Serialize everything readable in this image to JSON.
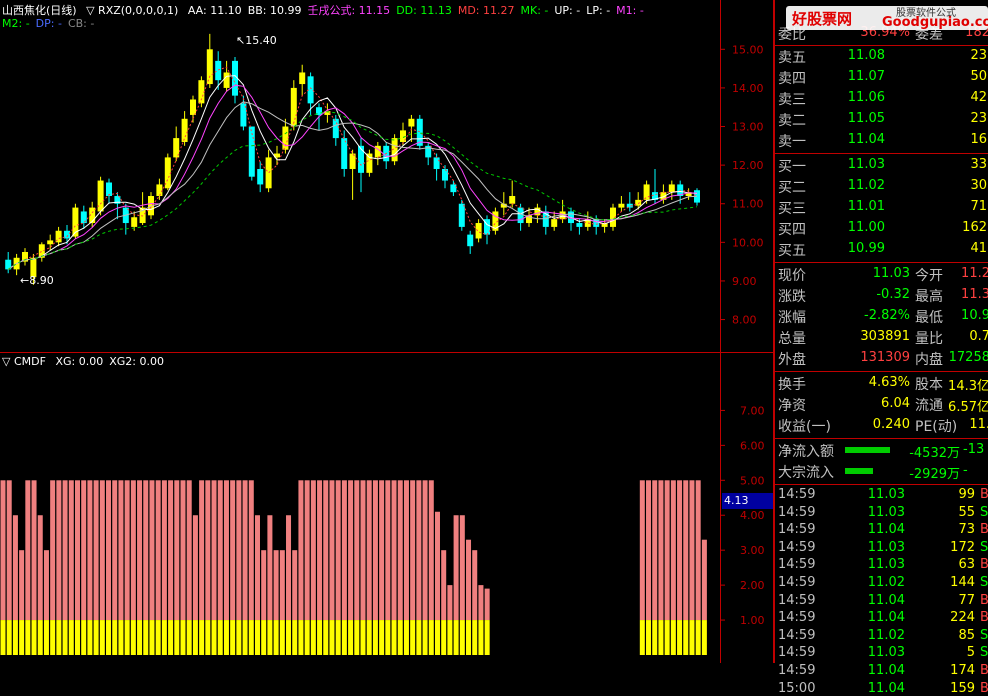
{
  "legend_main": {
    "title": "山西焦化(日线)",
    "indicator": "▽ RXZ(0,0,0,0,1)",
    "items": [
      {
        "label": "AA: 11.10",
        "color": "#ffffff"
      },
      {
        "label": "BB: 10.99",
        "color": "#ffffff"
      },
      {
        "label": "壬戌公式: 11.15",
        "color": "#ff44ff"
      },
      {
        "label": "DD: 11.13",
        "color": "#00ff00"
      },
      {
        "label": "MD: 11.27",
        "color": "#ff4040"
      },
      {
        "label": "MK: -",
        "color": "#00ff00"
      },
      {
        "label": "UP: -",
        "color": "#ffffff"
      },
      {
        "label": "LP: -",
        "color": "#ffffff"
      },
      {
        "label": "M1: -",
        "color": "#ff44ff"
      }
    ],
    "row2": [
      {
        "label": "M2: -",
        "color": "#00ff00"
      },
      {
        "label": "DP: -",
        "color": "#4a6bff"
      },
      {
        "label": "CB: -",
        "color": "#888888"
      }
    ]
  },
  "legend_sub": {
    "indicator": "▽ CMDF",
    "items": [
      {
        "label": "XG: 0.00",
        "color": "#ffffff"
      },
      {
        "label": "XG2: 0.00",
        "color": "#ffffff"
      }
    ]
  },
  "price_axis": [
    "15.00",
    "14.00",
    "13.00",
    "12.00",
    "11.00",
    "10.00",
    "9.00",
    "8.00"
  ],
  "sub_axis": [
    "7.00",
    "6.00",
    "5.00",
    "4.00",
    "3.00",
    "2.00",
    "1.00"
  ],
  "sub_current": "4.13",
  "annotations": {
    "high": "15.40",
    "low": "8.90"
  },
  "watermark": {
    "logo": "好股票网",
    "url": "Goodgupiao.com",
    "tag": "股票软件公式"
  },
  "quote_panel": {
    "ratio": {
      "label": "委比",
      "value": "36.94%",
      "label2": "委差",
      "value2": "182"
    },
    "sells": [
      {
        "label": "卖五",
        "price": "11.08",
        "vol": "23"
      },
      {
        "label": "卖四",
        "price": "11.07",
        "vol": "50"
      },
      {
        "label": "卖三",
        "price": "11.06",
        "vol": "42"
      },
      {
        "label": "卖二",
        "price": "11.05",
        "vol": "23"
      },
      {
        "label": "卖一",
        "price": "11.04",
        "vol": "16"
      }
    ],
    "buys": [
      {
        "label": "买一",
        "price": "11.03",
        "vol": "33"
      },
      {
        "label": "买二",
        "price": "11.02",
        "vol": "30"
      },
      {
        "label": "买三",
        "price": "11.01",
        "vol": "71"
      },
      {
        "label": "买四",
        "price": "11.00",
        "vol": "162"
      },
      {
        "label": "买五",
        "price": "10.99",
        "vol": "41"
      }
    ],
    "stats": [
      {
        "l1": "现价",
        "v1": "11.03",
        "c1": "#00ff00",
        "l2": "今开",
        "v2": "11.2",
        "c2": "#ff4040"
      },
      {
        "l1": "涨跌",
        "v1": "-0.32",
        "c1": "#00ff00",
        "l2": "最高",
        "v2": "11.3",
        "c2": "#ff4040"
      },
      {
        "l1": "涨幅",
        "v1": "-2.82%",
        "c1": "#00ff00",
        "l2": "最低",
        "v2": "10.9",
        "c2": "#00ff00"
      },
      {
        "l1": "总量",
        "v1": "303891",
        "c1": "#ffff00",
        "l2": "量比",
        "v2": "0.7",
        "c2": "#ffff00"
      },
      {
        "l1": "外盘",
        "v1": "131309",
        "c1": "#ff4040",
        "l2": "内盘",
        "v2": "17258",
        "c2": "#00ff00"
      }
    ],
    "stats2": [
      {
        "l1": "换手",
        "v1": "4.63%",
        "c1": "#ffff00",
        "l2": "股本",
        "v2": "14.3亿",
        "c2": "#ffff00"
      },
      {
        "l1": "净资",
        "v1": "6.04",
        "c1": "#ffff00",
        "l2": "流通",
        "v2": "6.57亿",
        "c2": "#ffff00"
      },
      {
        "l1": "收益(一)",
        "v1": "0.240",
        "c1": "#ffff00",
        "l2": "PE(动)",
        "v2": "11.",
        "c2": "#ffff00"
      }
    ],
    "flows": [
      {
        "label": "净流入额",
        "value": "-4532万",
        "value2": "-13"
      },
      {
        "label": "大宗流入",
        "value": "-2929万",
        "value2": "-"
      }
    ],
    "ticks": [
      {
        "time": "14:59",
        "price": "11.03",
        "vol": "99",
        "dir": "B"
      },
      {
        "time": "14:59",
        "price": "11.03",
        "vol": "55",
        "dir": "S"
      },
      {
        "time": "14:59",
        "price": "11.04",
        "vol": "73",
        "dir": "B"
      },
      {
        "time": "14:59",
        "price": "11.03",
        "vol": "172",
        "dir": "S"
      },
      {
        "time": "14:59",
        "price": "11.03",
        "vol": "63",
        "dir": "B"
      },
      {
        "time": "14:59",
        "price": "11.02",
        "vol": "144",
        "dir": "S"
      },
      {
        "time": "14:59",
        "price": "11.04",
        "vol": "77",
        "dir": "B"
      },
      {
        "time": "14:59",
        "price": "11.04",
        "vol": "224",
        "dir": "B"
      },
      {
        "time": "14:59",
        "price": "11.02",
        "vol": "85",
        "dir": "S"
      },
      {
        "time": "14:59",
        "price": "11.03",
        "vol": "5",
        "dir": "S"
      },
      {
        "time": "14:59",
        "price": "11.04",
        "vol": "174",
        "dir": "B"
      },
      {
        "time": "15:00",
        "price": "11.04",
        "vol": "159",
        "dir": "B"
      }
    ]
  },
  "colors": {
    "up": "#ffff00",
    "down": "#00ffff",
    "grid": "#800000",
    "axis": "#c00000",
    "bar_pink": "#f08080",
    "bar_yellow": "#ffff00"
  },
  "chart_data": {
    "type": "candlestick",
    "price_range": [
      7.6,
      15.5
    ],
    "candles": [
      {
        "o": 9.55,
        "c": 9.3,
        "h": 9.75,
        "l": 9.2
      },
      {
        "o": 9.3,
        "c": 9.6,
        "h": 9.7,
        "l": 9.15
      },
      {
        "o": 9.5,
        "c": 9.75,
        "h": 9.85,
        "l": 9.4
      },
      {
        "o": 9.1,
        "c": 9.6,
        "h": 9.7,
        "l": 8.9
      },
      {
        "o": 9.6,
        "c": 9.95,
        "h": 10.0,
        "l": 9.5
      },
      {
        "o": 9.95,
        "c": 10.05,
        "h": 10.2,
        "l": 9.8
      },
      {
        "o": 10.0,
        "c": 10.3,
        "h": 10.4,
        "l": 9.9
      },
      {
        "o": 10.3,
        "c": 10.1,
        "h": 10.45,
        "l": 9.95
      },
      {
        "o": 10.15,
        "c": 10.9,
        "h": 11.0,
        "l": 10.1
      },
      {
        "o": 10.8,
        "c": 10.5,
        "h": 10.95,
        "l": 10.35
      },
      {
        "o": 10.5,
        "c": 10.9,
        "h": 11.05,
        "l": 10.4
      },
      {
        "o": 10.8,
        "c": 11.6,
        "h": 11.7,
        "l": 10.7
      },
      {
        "o": 11.55,
        "c": 11.2,
        "h": 11.65,
        "l": 11.0
      },
      {
        "o": 11.2,
        "c": 11.0,
        "h": 11.3,
        "l": 10.6
      },
      {
        "o": 10.9,
        "c": 10.5,
        "h": 11.0,
        "l": 10.2
      },
      {
        "o": 10.4,
        "c": 10.65,
        "h": 10.8,
        "l": 10.3
      },
      {
        "o": 10.5,
        "c": 10.9,
        "h": 11.3,
        "l": 10.45
      },
      {
        "o": 10.7,
        "c": 11.2,
        "h": 11.3,
        "l": 10.6
      },
      {
        "o": 11.2,
        "c": 11.5,
        "h": 11.65,
        "l": 11.1
      },
      {
        "o": 11.4,
        "c": 12.2,
        "h": 12.3,
        "l": 11.35
      },
      {
        "o": 12.2,
        "c": 12.7,
        "h": 13.0,
        "l": 12.1
      },
      {
        "o": 12.6,
        "c": 13.2,
        "h": 13.4,
        "l": 12.5
      },
      {
        "o": 13.3,
        "c": 13.7,
        "h": 13.8,
        "l": 13.1
      },
      {
        "o": 13.6,
        "c": 14.2,
        "h": 14.3,
        "l": 13.5
      },
      {
        "o": 14.1,
        "c": 15.0,
        "h": 15.4,
        "l": 14.0
      },
      {
        "o": 14.7,
        "c": 14.2,
        "h": 14.95,
        "l": 13.95
      },
      {
        "o": 14.0,
        "c": 14.4,
        "h": 14.7,
        "l": 13.9
      },
      {
        "o": 14.7,
        "c": 13.8,
        "h": 14.8,
        "l": 13.6
      },
      {
        "o": 13.6,
        "c": 13.0,
        "h": 13.8,
        "l": 12.9
      },
      {
        "o": 13.0,
        "c": 11.7,
        "h": 13.0,
        "l": 11.6
      },
      {
        "o": 11.9,
        "c": 11.5,
        "h": 12.1,
        "l": 11.3
      },
      {
        "o": 11.4,
        "c": 12.2,
        "h": 12.4,
        "l": 11.3
      },
      {
        "o": 12.2,
        "c": 12.3,
        "h": 12.5,
        "l": 12.0
      },
      {
        "o": 12.4,
        "c": 13.0,
        "h": 13.2,
        "l": 12.3
      },
      {
        "o": 13.0,
        "c": 14.0,
        "h": 14.2,
        "l": 12.9
      },
      {
        "o": 14.1,
        "c": 14.4,
        "h": 14.6,
        "l": 13.8
      },
      {
        "o": 14.3,
        "c": 13.6,
        "h": 14.4,
        "l": 13.3
      },
      {
        "o": 13.5,
        "c": 13.3,
        "h": 13.6,
        "l": 12.9
      },
      {
        "o": 13.3,
        "c": 13.4,
        "h": 13.6,
        "l": 13.1
      },
      {
        "o": 13.2,
        "c": 12.7,
        "h": 13.3,
        "l": 12.5
      },
      {
        "o": 12.7,
        "c": 11.9,
        "h": 12.9,
        "l": 11.7
      },
      {
        "o": 11.9,
        "c": 12.3,
        "h": 12.4,
        "l": 11.1
      },
      {
        "o": 12.5,
        "c": 11.8,
        "h": 12.7,
        "l": 11.3
      },
      {
        "o": 11.8,
        "c": 12.3,
        "h": 12.4,
        "l": 11.7
      },
      {
        "o": 12.2,
        "c": 12.5,
        "h": 12.6,
        "l": 12.0
      },
      {
        "o": 12.5,
        "c": 12.1,
        "h": 12.6,
        "l": 11.9
      },
      {
        "o": 12.1,
        "c": 12.7,
        "h": 12.8,
        "l": 12.0
      },
      {
        "o": 12.6,
        "c": 12.9,
        "h": 13.1,
        "l": 12.5
      },
      {
        "o": 13.0,
        "c": 13.2,
        "h": 13.3,
        "l": 12.6
      },
      {
        "o": 13.2,
        "c": 12.5,
        "h": 13.3,
        "l": 12.4
      },
      {
        "o": 12.5,
        "c": 12.2,
        "h": 12.6,
        "l": 12.0
      },
      {
        "o": 12.2,
        "c": 11.9,
        "h": 12.3,
        "l": 11.6
      },
      {
        "o": 11.9,
        "c": 11.6,
        "h": 12.0,
        "l": 11.4
      },
      {
        "o": 11.5,
        "c": 11.3,
        "h": 11.6,
        "l": 11.2
      },
      {
        "o": 11.0,
        "c": 10.4,
        "h": 11.1,
        "l": 10.3
      },
      {
        "o": 10.2,
        "c": 9.9,
        "h": 10.3,
        "l": 9.7
      },
      {
        "o": 10.1,
        "c": 10.5,
        "h": 10.6,
        "l": 10.0
      },
      {
        "o": 10.6,
        "c": 10.2,
        "h": 10.7,
        "l": 9.95
      },
      {
        "o": 10.3,
        "c": 10.8,
        "h": 10.9,
        "l": 10.2
      },
      {
        "o": 10.9,
        "c": 11.0,
        "h": 11.3,
        "l": 10.7
      },
      {
        "o": 11.0,
        "c": 11.2,
        "h": 11.6,
        "l": 10.9
      },
      {
        "o": 10.9,
        "c": 10.5,
        "h": 11.0,
        "l": 10.3
      },
      {
        "o": 10.5,
        "c": 10.7,
        "h": 10.9,
        "l": 10.4
      },
      {
        "o": 10.7,
        "c": 10.9,
        "h": 11.0,
        "l": 10.5
      },
      {
        "o": 10.8,
        "c": 10.4,
        "h": 10.95,
        "l": 10.2
      },
      {
        "o": 10.4,
        "c": 10.6,
        "h": 10.8,
        "l": 10.3
      },
      {
        "o": 10.6,
        "c": 10.8,
        "h": 11.1,
        "l": 10.5
      },
      {
        "o": 10.8,
        "c": 10.5,
        "h": 10.9,
        "l": 10.3
      },
      {
        "o": 10.5,
        "c": 10.4,
        "h": 10.6,
        "l": 10.2
      },
      {
        "o": 10.4,
        "c": 10.6,
        "h": 10.8,
        "l": 10.3
      },
      {
        "o": 10.6,
        "c": 10.4,
        "h": 10.7,
        "l": 10.2
      },
      {
        "o": 10.4,
        "c": 10.5,
        "h": 10.6,
        "l": 10.25
      },
      {
        "o": 10.4,
        "c": 10.9,
        "h": 11.0,
        "l": 10.3
      },
      {
        "o": 10.9,
        "c": 11.0,
        "h": 11.2,
        "l": 10.8
      },
      {
        "o": 11.0,
        "c": 10.9,
        "h": 11.3,
        "l": 10.8
      },
      {
        "o": 10.95,
        "c": 11.1,
        "h": 11.3,
        "l": 10.85
      },
      {
        "o": 11.1,
        "c": 11.5,
        "h": 11.6,
        "l": 11.0
      },
      {
        "o": 11.3,
        "c": 11.1,
        "h": 11.9,
        "l": 11.0
      },
      {
        "o": 11.1,
        "c": 11.3,
        "h": 11.5,
        "l": 11.0
      },
      {
        "o": 11.3,
        "c": 11.5,
        "h": 11.6,
        "l": 11.1
      },
      {
        "o": 11.5,
        "c": 11.2,
        "h": 11.6,
        "l": 11.0
      },
      {
        "o": 11.2,
        "c": 11.3,
        "h": 11.4,
        "l": 11.1
      },
      {
        "o": 11.35,
        "c": 11.03,
        "h": 11.4,
        "l": 10.95
      }
    ],
    "sub_range": [
      0,
      8.3
    ],
    "sub_bars": [
      5,
      5,
      4,
      3,
      5,
      5,
      4,
      3,
      5,
      5,
      5,
      5,
      5,
      5,
      5,
      5,
      5,
      5,
      5,
      5,
      5,
      5,
      5,
      5,
      5,
      5,
      5,
      5,
      5,
      5,
      5,
      4,
      5,
      5,
      5,
      5,
      5,
      5,
      5,
      5,
      5,
      4,
      3,
      4,
      3,
      3,
      4,
      3,
      5,
      5,
      5,
      5,
      5,
      5,
      5,
      5,
      5,
      5,
      5,
      5,
      5,
      5,
      5,
      5,
      5,
      5,
      5,
      5,
      5,
      5,
      4.1,
      3,
      2,
      4,
      4,
      3.3,
      3,
      2,
      1.9,
      0,
      0,
      0,
      0,
      0,
      0,
      0,
      0,
      0,
      0,
      0,
      0,
      0,
      0,
      0,
      0,
      0,
      0,
      0,
      0,
      0,
      0,
      0,
      0,
      5,
      5,
      5,
      5,
      5,
      5,
      5,
      5,
      5,
      5,
      3.3,
      0,
      0
    ],
    "sub_current": 4.13
  }
}
